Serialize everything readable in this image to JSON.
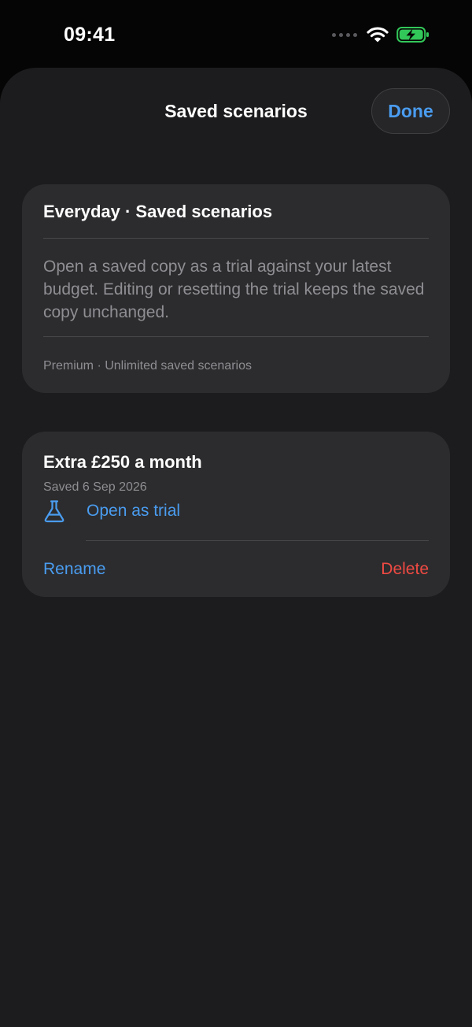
{
  "status_bar": {
    "time": "09:41",
    "icons": [
      "cellular-signal-icon",
      "wifi-icon",
      "battery-charging-icon"
    ],
    "battery_color": "#32c759"
  },
  "sheet": {
    "title": "Saved scenarios",
    "done_label": "Done"
  },
  "info_card": {
    "title": "Everyday · Saved scenarios",
    "body": "Open a saved copy as a trial against your latest budget. Editing or resetting the trial keeps the saved copy unchanged.",
    "footer": "Premium · Unlimited saved scenarios"
  },
  "scenarios": [
    {
      "name": "Extra £250 a month",
      "saved_date": "Saved 6 Sep 2026",
      "open_label": "Open as trial",
      "open_icon": "flask-icon",
      "rename_label": "Rename",
      "delete_label": "Delete"
    }
  ],
  "colors": {
    "accent": "#4a9cf0",
    "destructive": "#ef4a43",
    "card": "#2c2c2e",
    "sheet": "#1c1c1e"
  }
}
